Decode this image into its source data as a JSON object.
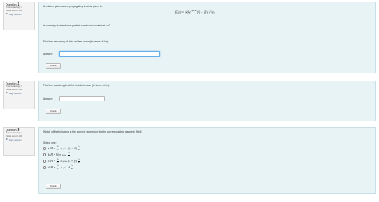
{
  "question1": {
    "label": "Question",
    "number": "1",
    "time_remaining": "Time remaining: 3",
    "points": "Points out of 1.00",
    "flag": "Flag question",
    "text": "A uniform plane wave propagating in air is given by:",
    "formula": "E(z) = 60 e",
    "formula_exp": "-j60πz",
    "formula_vec": "(ŷ − jẑ)",
    "formula_unit": "V/m",
    "line2": "is normally incident on a perfect conductor located at x=0.",
    "line3": "Find the frequency of this incident wave (in terms of Hz).",
    "answer_label": "Answer:",
    "answer_value": "",
    "check": "Check"
  },
  "question2": {
    "label": "Question",
    "number": "2",
    "time_remaining": "Time remaining: 3",
    "points": "Points out of 1.00",
    "flag": "Flag question",
    "text": "Find the wavelength of this incident wave (in terms of m).",
    "answer_label": "Answer:",
    "answer_value": "",
    "check": "Check"
  },
  "question3": {
    "label": "Question",
    "number": "3",
    "time_remaining": "Time remaining: 3",
    "points": "Points out of 1.00",
    "flag": "Flag question",
    "text": "Which of the following is the correct expression for the corresponding magnetic field?",
    "select_one": "Select one:",
    "options": [
      {
        "letter": "a.",
        "lhs": "H",
        "coef_n": "60",
        "coef_d": "377",
        "exp": "-j60πz",
        "vec": "(ŷ − jẑ)",
        "unit_n": "A",
        "unit_d": "m"
      },
      {
        "letter": "b.",
        "lhs": "H",
        "coef": "60 e",
        "exp": "-j60πz",
        "vec": "",
        "unit_n": "A",
        "unit_d": "m"
      },
      {
        "letter": "c.",
        "lhs": "H",
        "coef_n": "60",
        "coef_d": "377",
        "exp": "-j60πz",
        "vec": "(ẑ + jŷ)",
        "unit_n": "A",
        "unit_d": "m"
      },
      {
        "letter": "d.",
        "lhs": "H",
        "coef_n": "60",
        "coef_d": "377",
        "exp": "-j60πz",
        "vec": "ẑ",
        "unit_n": "A",
        "unit_d": "m"
      }
    ],
    "check": "Check"
  },
  "colors": {
    "content_bg": "#e7f3f5",
    "info_bg": "#f3f3f3",
    "focus": "#66afe9",
    "link": "#4d6f95"
  }
}
